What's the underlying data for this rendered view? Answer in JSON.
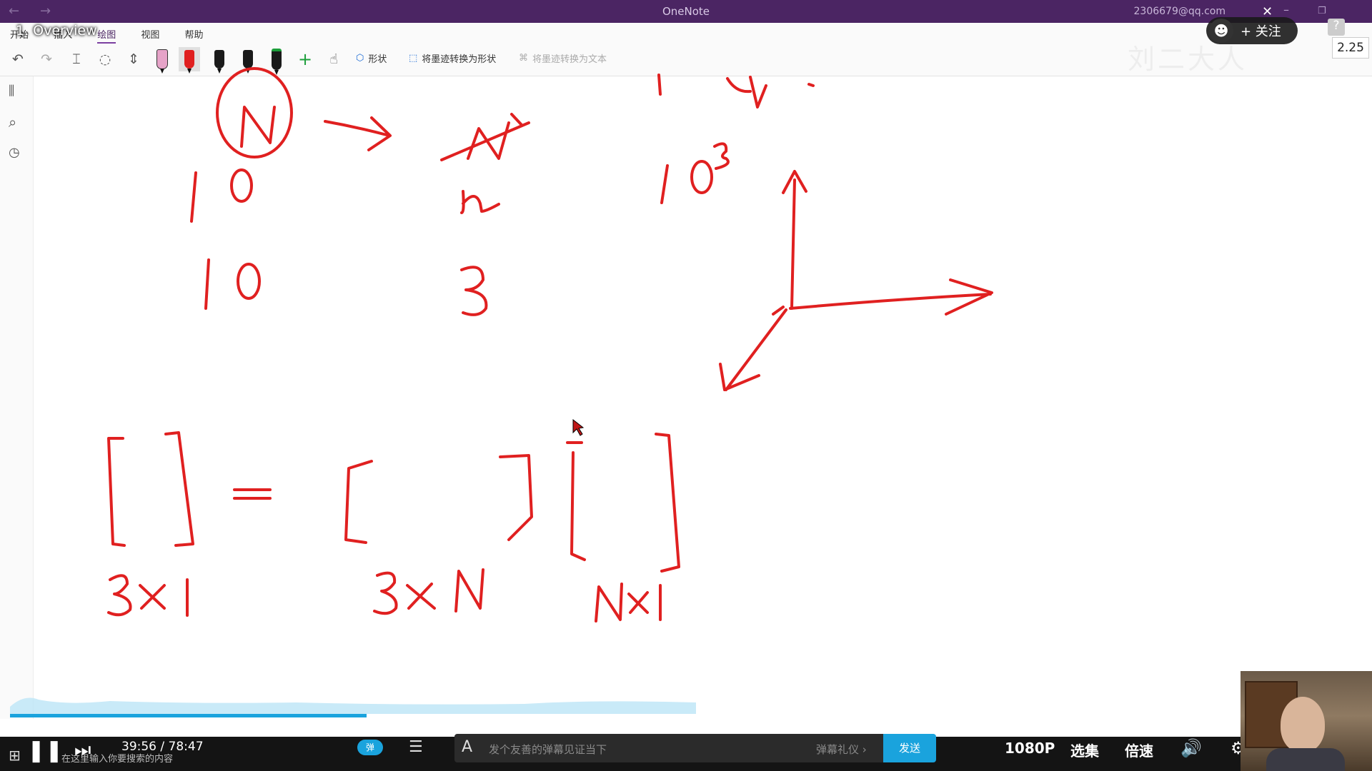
{
  "window": {
    "title": "OneNote",
    "account": "2306679@qq.com",
    "back_glyph": "←",
    "forward_glyph": "→",
    "minimize_glyph": "–",
    "restore_glyph": "❐",
    "close_glyph": "✕"
  },
  "ribbon": {
    "tabs": [
      "开始",
      "插入",
      "绘图",
      "视图",
      "帮助"
    ],
    "active_tab": "绘图",
    "tools": {
      "undo": "↶",
      "redo": "↷",
      "select_text": "⌶",
      "lasso": "◌",
      "insert_space": "⇕",
      "add_pen": "+",
      "ink_to_shape_icon": "⬡"
    },
    "buttons": {
      "shapes": "形状",
      "ink_to_shape": "将墨迹转换为形状",
      "ink_to_text": "将墨迹转换为文本"
    },
    "pens": [
      {
        "name": "highlighter-pink",
        "color": "#e6a3c8",
        "tip": "#111111"
      },
      {
        "name": "pen-red",
        "color": "#e02020",
        "tip": "#111111",
        "selected": true
      },
      {
        "name": "pen-black-1",
        "color": "#1a1a1a",
        "tip": "#1a6ad4"
      },
      {
        "name": "pen-black-2",
        "color": "#1a1a1a",
        "tip": "#111111"
      },
      {
        "name": "pen-green",
        "color": "#1a1a1a",
        "tip": "#1c9e3a"
      }
    ]
  },
  "overlay": {
    "video_title": "1. Overview",
    "follow_label": "+ 关注",
    "avatar_icon": "☻",
    "speed_badge": "2.25",
    "help": "?",
    "watermark": "刘二大人"
  },
  "sidebar": {
    "icons": [
      "notebooks-icon",
      "search-icon",
      "recent-icon"
    ],
    "glyphs": [
      "⫼",
      "⌕",
      "◷"
    ]
  },
  "player": {
    "current_time": "39:56",
    "total_time": "78:47",
    "progress": 0.507,
    "danmaku_toggle": "弹",
    "danmaku_placeholder": "发个友善的弹幕见证当下",
    "danmaku_etiquette": "弹幕礼仪 ›",
    "send_label": "发送",
    "quality": "1080P",
    "episodes": "选集",
    "speed": "倍速",
    "play_icon": "❚❚",
    "next_icon": "⏭",
    "volume_icon": "🔊",
    "settings_icon": "⚙",
    "fullscreen_icon": "⛶",
    "screen_icon": "⧉"
  },
  "taskbar": {
    "search_hint": "在这里输入你要搜索的内容",
    "start_icon": "⊞"
  },
  "ink": {
    "color": "#e02020",
    "items": [
      "circled-N",
      "arrow-right",
      "struck-N",
      "ten-row1",
      "n-label",
      "ten-cubed",
      "ten-row2",
      "three",
      "3d-axes",
      "matrix-left-3x1",
      "equals-sign",
      "matrix-3xN",
      "matrix-Nx1",
      "label-3x1",
      "label-3xN",
      "label-Nx1"
    ]
  }
}
